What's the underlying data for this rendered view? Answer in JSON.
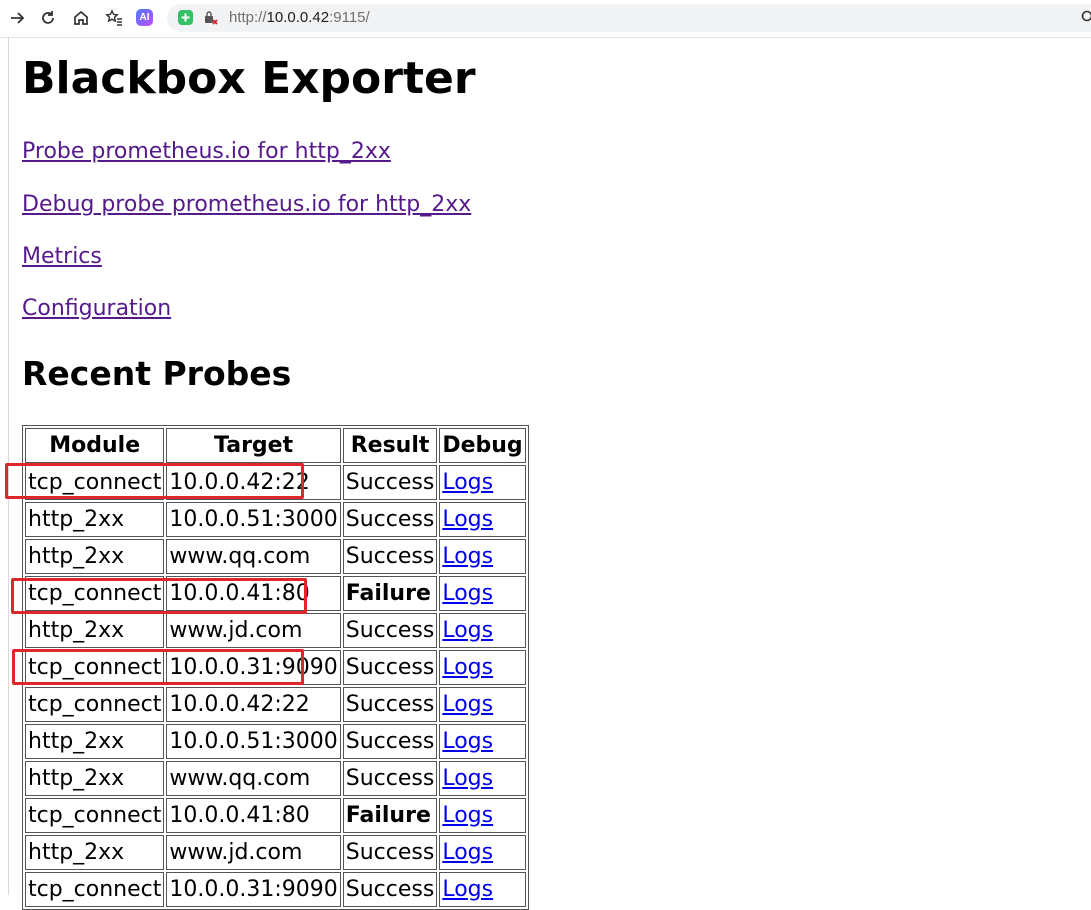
{
  "browser": {
    "url_scheme": "http://",
    "url_host": "10.0.0.42",
    "url_rest": ":9115/",
    "ai_badge": "AI",
    "icons": [
      "back-arrow-icon",
      "reload-icon",
      "home-icon",
      "favorites-icon",
      "ai-icon",
      "extension-shield-icon",
      "not-secure-icon",
      "search-icon"
    ]
  },
  "page": {
    "title": "Blackbox Exporter",
    "links": [
      "Probe prometheus.io for http_2xx",
      "Debug probe prometheus.io for http_2xx",
      "Metrics",
      "Configuration"
    ],
    "section_title": "Recent Probes"
  },
  "table": {
    "headers": [
      "Module",
      "Target",
      "Result",
      "Debug"
    ],
    "rows": [
      {
        "module": "tcp_connect",
        "target": "10.0.0.42:22",
        "result": "Success",
        "debug": "Logs",
        "failed": false
      },
      {
        "module": "http_2xx",
        "target": "10.0.0.51:3000",
        "result": "Success",
        "debug": "Logs",
        "failed": false
      },
      {
        "module": "http_2xx",
        "target": "www.qq.com",
        "result": "Success",
        "debug": "Logs",
        "failed": false
      },
      {
        "module": "tcp_connect",
        "target": "10.0.0.41:80",
        "result": "Failure",
        "debug": "Logs",
        "failed": true
      },
      {
        "module": "http_2xx",
        "target": "www.jd.com",
        "result": "Success",
        "debug": "Logs",
        "failed": false
      },
      {
        "module": "tcp_connect",
        "target": "10.0.0.31:9090",
        "result": "Success",
        "debug": "Logs",
        "failed": false
      },
      {
        "module": "tcp_connect",
        "target": "10.0.0.42:22",
        "result": "Success",
        "debug": "Logs",
        "failed": false
      },
      {
        "module": "http_2xx",
        "target": "10.0.0.51:3000",
        "result": "Success",
        "debug": "Logs",
        "failed": false
      },
      {
        "module": "http_2xx",
        "target": "www.qq.com",
        "result": "Success",
        "debug": "Logs",
        "failed": false
      },
      {
        "module": "tcp_connect",
        "target": "10.0.0.41:80",
        "result": "Failure",
        "debug": "Logs",
        "failed": true
      },
      {
        "module": "http_2xx",
        "target": "www.jd.com",
        "result": "Success",
        "debug": "Logs",
        "failed": false
      },
      {
        "module": "tcp_connect",
        "target": "10.0.0.31:9090",
        "result": "Success",
        "debug": "Logs",
        "failed": false
      }
    ]
  },
  "colors": {
    "visited_link": "#551a8b",
    "link": "#0000ee",
    "highlight": "#e0262c"
  }
}
